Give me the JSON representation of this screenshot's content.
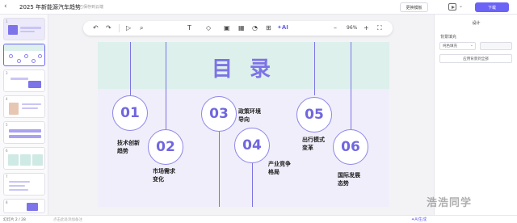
{
  "topbar": {
    "doc_title": "2025 年新能源汽车趋势",
    "doc_status": "已保存到云端",
    "template_button": "更换模板",
    "download_button": "下载"
  },
  "thumbnails": [
    "1",
    "2",
    "3",
    "4",
    "5",
    "6",
    "7",
    "8"
  ],
  "toolbar": {
    "undo": "↶",
    "redo": "↷",
    "cursor": "▷",
    "zoom_search": "⌕",
    "text": "T",
    "shape": "◇",
    "image": "▣",
    "table": "▦",
    "chart": "◔",
    "icon": "⊞",
    "ai_label": "✦AI",
    "zoom_out": "–",
    "zoom_value": "96%",
    "zoom_in": "+",
    "fullscreen": "⛶"
  },
  "slide": {
    "title": "目 录",
    "items": [
      {
        "number": "01",
        "label": "技术创新\n趋势"
      },
      {
        "number": "02",
        "label": "市场需求\n变化"
      },
      {
        "number": "03",
        "label": "政策环境\n导向"
      },
      {
        "number": "04",
        "label": "产业竞争\n格局"
      },
      {
        "number": "05",
        "label": "出行模式\n变革"
      },
      {
        "number": "06",
        "label": "国际发展\n态势"
      }
    ]
  },
  "right_panel": {
    "heading": "设计",
    "background_label": "背景填充",
    "fill_value": "纯色填充",
    "apply_all": "应用背景到全部"
  },
  "bottombar": {
    "page_count": "幻灯片 2 / 28",
    "notes_placeholder": "点击此处添加备注",
    "ai_generate": "✦AI生成"
  },
  "watermark": "浩浩同学",
  "colors": {
    "accent": "#6b63f6",
    "slide_header": "#ddf0ec",
    "slide_body": "#efeefa",
    "circle_text": "#6f67df"
  }
}
